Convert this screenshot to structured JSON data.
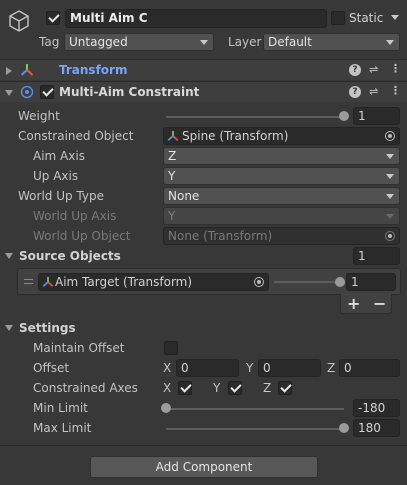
{
  "gameobject": {
    "name": "Multi Aim C",
    "static_label": "Static",
    "tag_label": "Tag",
    "tag_value": "Untagged",
    "layer_label": "Layer",
    "layer_value": "Default"
  },
  "transform": {
    "title": "Transform"
  },
  "component": {
    "title": "Multi-Aim Constraint"
  },
  "fields": {
    "weight_label": "Weight",
    "weight_value": "1",
    "weight_fraction": 1,
    "constrained_object_label": "Constrained Object",
    "constrained_object_value": "Spine (Transform)",
    "aim_axis_label": "Aim Axis",
    "aim_axis_value": "Z",
    "up_axis_label": "Up Axis",
    "up_axis_value": "Y",
    "world_up_type_label": "World Up Type",
    "world_up_type_value": "None",
    "world_up_axis_label": "World Up Axis",
    "world_up_axis_value": "Y",
    "world_up_object_label": "World Up Object",
    "world_up_object_value": "None (Transform)"
  },
  "source_objects": {
    "title": "Source Objects",
    "count": "1",
    "item_label": "Aim Target (Transform)",
    "item_weight": "1",
    "item_weight_fraction": 1,
    "add": "+",
    "remove": "−"
  },
  "settings": {
    "title": "Settings",
    "maintain_offset_label": "Maintain Offset",
    "offset_label": "Offset",
    "x": "X",
    "y": "Y",
    "z": "Z",
    "offset_x": "0",
    "offset_y": "0",
    "offset_z": "0",
    "constrained_axes_label": "Constrained Axes",
    "min_limit_label": "Min Limit",
    "min_limit_value": "-180",
    "min_fraction": 0,
    "max_limit_label": "Max Limit",
    "max_limit_value": "180",
    "max_fraction": 1
  },
  "add_component": "Add Component",
  "colors": {
    "transform_title": "#7ba4f5",
    "bg": "#383838"
  }
}
